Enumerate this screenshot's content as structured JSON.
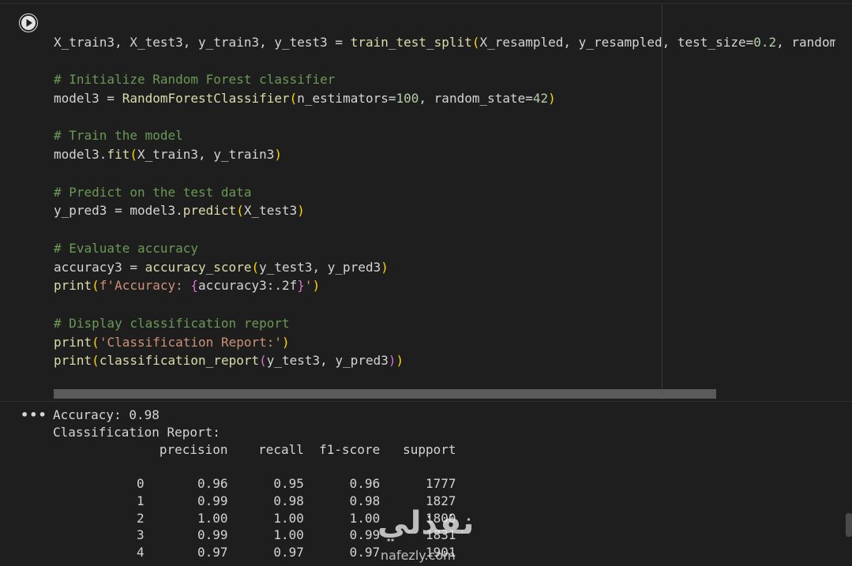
{
  "code": {
    "line1": {
      "a": "X_train3, X_test3, y_train3, y_test3 = ",
      "fn": "train_test_split",
      "p1": "(",
      "b": "X_resampled, y_resampled, test_size=",
      "num": "0.2",
      "c": ", random"
    },
    "line2": "# Initialize Random Forest classifier",
    "line3": {
      "a": "model3 = ",
      "fn": "RandomForestClassifier",
      "p1": "(",
      "b": "n_estimators=",
      "num1": "100",
      "c": ", random_state=",
      "num2": "42",
      "p2": ")"
    },
    "line4": "# Train the model",
    "line5": {
      "a": "model3.",
      "fn": "fit",
      "p1": "(",
      "b": "X_train3, y_train3",
      "p2": ")"
    },
    "line6": "# Predict on the test data",
    "line7": {
      "a": "y_pred3 = model3.",
      "fn": "predict",
      "p1": "(",
      "b": "X_test3",
      "p2": ")"
    },
    "line8": "# Evaluate accuracy",
    "line9": {
      "a": "accuracy3 = ",
      "fn": "accuracy_score",
      "p1": "(",
      "b": "y_test3, y_pred3",
      "p2": ")"
    },
    "line10": {
      "fn": "print",
      "p1": "(",
      "str1": "f'Accuracy: ",
      "p3": "{",
      "b": "accuracy3:.2f",
      "p4": "}",
      "str2": "'",
      "p2": ")"
    },
    "line11": "# Display classification report",
    "line12": {
      "fn": "print",
      "p1": "(",
      "str": "'Classification Report:'",
      "p2": ")"
    },
    "line13": {
      "fn": "print",
      "p1": "(",
      "fn2": "classification_report",
      "p3": "(",
      "b": "y_test3, y_pred3",
      "p4": ")",
      "p2": ")"
    }
  },
  "output": {
    "accuracy": "Accuracy: 0.98",
    "report_title": "Classification Report:",
    "header": "              precision    recall  f1-score   support",
    "rows": [
      "           0       0.96      0.95      0.96      1777",
      "           1       0.99      0.98      0.98      1827",
      "           2       1.00      1.00      1.00      1800",
      "           3       0.99      1.00      0.99      1831",
      "           4       0.97      0.97      0.97      1901"
    ]
  },
  "output_menu": "•••",
  "watermark": {
    "arabic": "نفذلي",
    "latin": "nafezly.com"
  },
  "colors": {
    "background": "#1e1e1e",
    "comment": "#6a9955",
    "function": "#dcdcaa",
    "bracket": "#ffd700",
    "string": "#ce9178"
  }
}
